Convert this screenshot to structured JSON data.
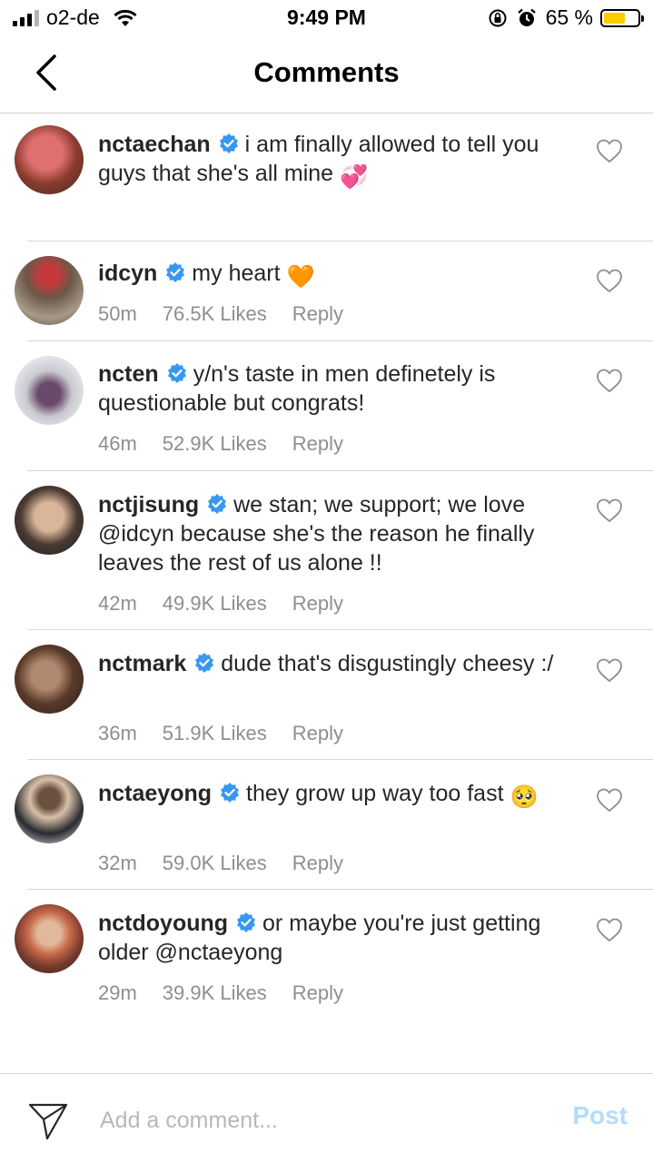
{
  "status": {
    "carrier": "o2-de",
    "time": "9:49 PM",
    "battery_percent": "65 %",
    "battery_level": 0.65,
    "battery_color": "#ffcc00"
  },
  "header": {
    "title": "Comments"
  },
  "colors": {
    "verified": "#3897f0",
    "meta": "#8e8e8e",
    "post_disabled": "#b3dbff"
  },
  "comments": [
    {
      "username": "nctaechan",
      "text": "i am finally allowed to tell you guys that she's all mine",
      "emoji": "💞",
      "time": "",
      "likes": "",
      "reply": ""
    },
    {
      "username": "idcyn",
      "text": "my heart",
      "emoji": "🧡",
      "time": "50m",
      "likes": "76.5K Likes",
      "reply": "Reply"
    },
    {
      "username": "ncten",
      "text": "y/n's taste in men definetely is questionable but congrats!",
      "emoji": "",
      "time": "46m",
      "likes": "52.9K Likes",
      "reply": "Reply"
    },
    {
      "username": "nctjisung",
      "text": "we stan; we support; we love @idcyn  because she's the reason he finally leaves the rest of us alone !!",
      "emoji": "",
      "time": "42m",
      "likes": "49.9K Likes",
      "reply": "Reply"
    },
    {
      "username": "nctmark",
      "text": "dude that's disgustingly cheesy :/",
      "emoji": "",
      "time": "36m",
      "likes": "51.9K Likes",
      "reply": "Reply"
    },
    {
      "username": "nctaeyong",
      "text": "they grow up way too fast",
      "emoji": "🥺",
      "time": "32m",
      "likes": "59.0K Likes",
      "reply": "Reply"
    },
    {
      "username": "nctdoyoung",
      "text": "or maybe you're just getting older @nctaeyong",
      "emoji": "",
      "time": "29m",
      "likes": "39.9K Likes",
      "reply": "Reply"
    }
  ],
  "footer": {
    "placeholder": "Add a comment...",
    "post_label": "Post"
  }
}
